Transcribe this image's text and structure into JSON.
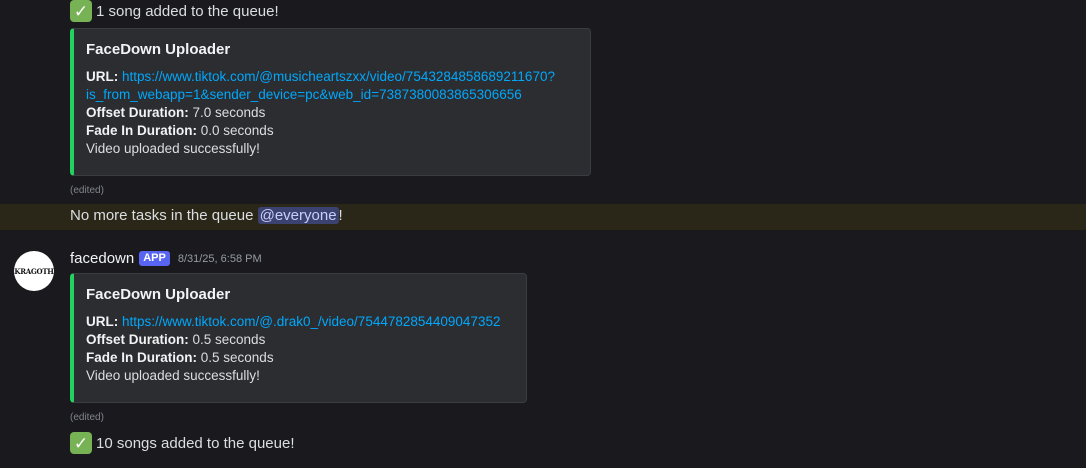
{
  "messages": {
    "added1": {
      "emoji": "✓",
      "text": "1 song added to the queue!"
    },
    "embed1": {
      "title": "FaceDown Uploader",
      "url_label": "URL:",
      "url_line1": "https://www.tiktok.com/@musicheartszxx/video/7543284858689211670?",
      "url_line2": "is_from_webapp=1&sender_device=pc&web_id=7387380083865306656",
      "offset_label": "Offset Duration:",
      "offset_value": "7.0 seconds",
      "fade_label": "Fade In Duration:",
      "fade_value": "0.0 seconds",
      "status": "Video uploaded successfully!"
    },
    "edited1": "(edited)",
    "no_tasks": {
      "text": "No more tasks in the queue ",
      "mention": "@everyone",
      "suffix": "!"
    },
    "author": {
      "name": "facedown",
      "badge": "APP",
      "timestamp": "8/31/25, 6:58 PM",
      "avatar_text": "KRAGOTH"
    },
    "embed2": {
      "title": "FaceDown Uploader",
      "url_label": "URL:",
      "url": "https://www.tiktok.com/@.drak0_/video/7544782854409047352",
      "offset_label": "Offset Duration:",
      "offset_value": "0.5 seconds",
      "fade_label": "Fade In Duration:",
      "fade_value": "0.5 seconds",
      "status": "Video uploaded successfully!"
    },
    "edited2": "(edited)",
    "added10": {
      "emoji": "✓",
      "text": "10 songs added to the queue!"
    }
  },
  "colors": {
    "accent_bar": "#23d160",
    "link": "#00a8fc",
    "badge": "#5865f2",
    "mention_bg": "#3c4270"
  }
}
